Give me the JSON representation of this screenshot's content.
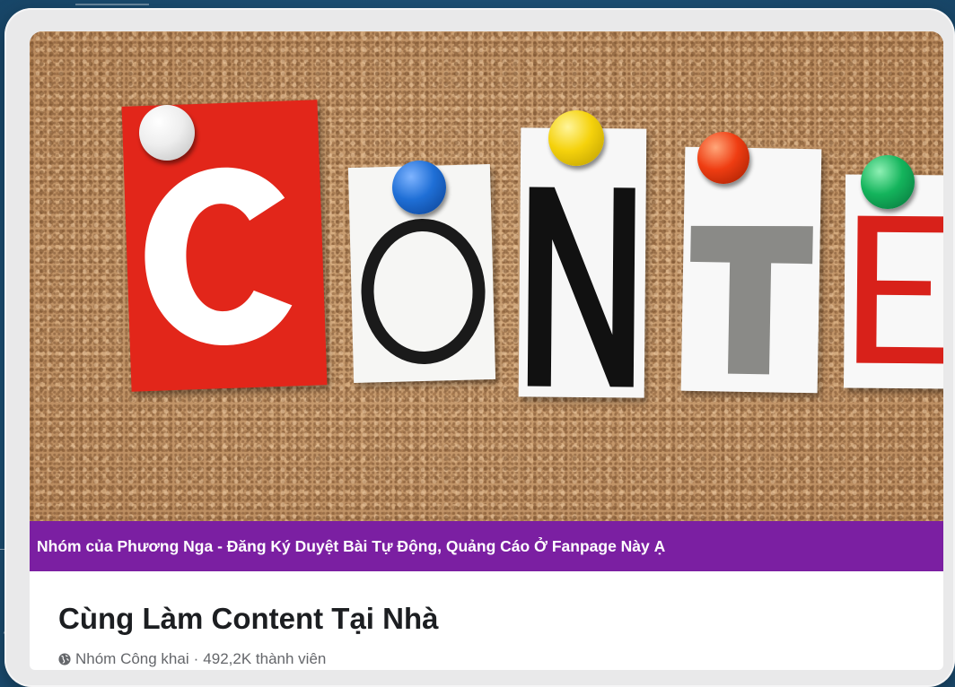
{
  "cover": {
    "letters": [
      "C",
      "O",
      "N",
      "T",
      "E"
    ]
  },
  "banner": {
    "text": "Nhóm của Phương Nga - Đăng Ký Duyệt Bài Tự Động, Quảng Cáo Ở Fanpage Này Ạ",
    "color": "#7b1fa2"
  },
  "group": {
    "title": "Cùng Làm Content Tại Nhà",
    "privacy_icon": "globe-icon",
    "privacy": "Nhóm Công khai",
    "separator": "·",
    "members": "492,2K thành viên"
  }
}
